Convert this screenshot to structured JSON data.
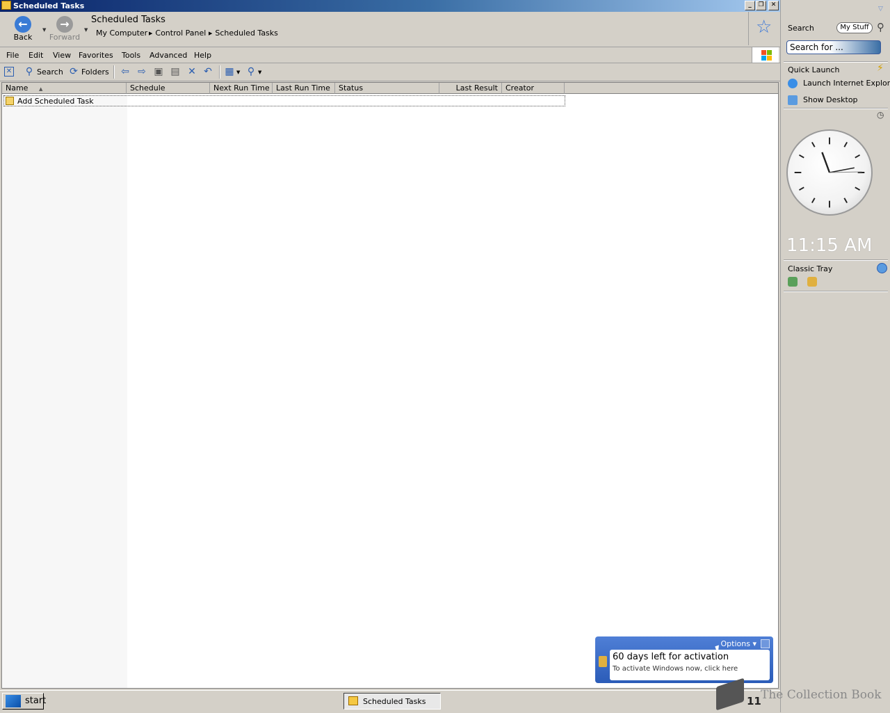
{
  "window": {
    "title": "Scheduled Tasks"
  },
  "nav": {
    "back_label": "Back",
    "forward_label": "Forward",
    "location_title": "Scheduled Tasks",
    "breadcrumbs": [
      "My Computer",
      "Control Panel",
      "Scheduled Tasks"
    ]
  },
  "menu": [
    "File",
    "Edit",
    "View",
    "Favorites",
    "Tools",
    "Advanced",
    "Help"
  ],
  "toolbar": {
    "search_label": "Search",
    "folders_label": "Folders"
  },
  "table": {
    "columns": [
      "Name",
      "Schedule",
      "Next Run Time",
      "Last Run Time",
      "Status",
      "Last Result",
      "Creator"
    ],
    "rows": [
      {
        "name": "Add Scheduled Task"
      }
    ]
  },
  "sidebar": {
    "search": {
      "title": "Search",
      "mystuff_label": "My Stuff",
      "placeholder": "Search for ..."
    },
    "quick_launch": {
      "title": "Quick Launch",
      "items": [
        "Launch Internet Explore",
        "Show Desktop"
      ]
    },
    "clock": {
      "time": "11:15 AM"
    },
    "classic_tray": {
      "title": "Classic Tray"
    }
  },
  "taskbar": {
    "start_label": "start",
    "task_item": "Scheduled Tasks"
  },
  "balloon": {
    "options_label": "Options",
    "heading": "60 days left for activation",
    "subtext": "To activate Windows now, click here"
  },
  "watermark": {
    "text": "The Collection Book",
    "clock": "11"
  },
  "colors": {
    "title_bar": "#0a246a",
    "accent": "#3a6ea5",
    "chrome": "#d4d0c8"
  }
}
